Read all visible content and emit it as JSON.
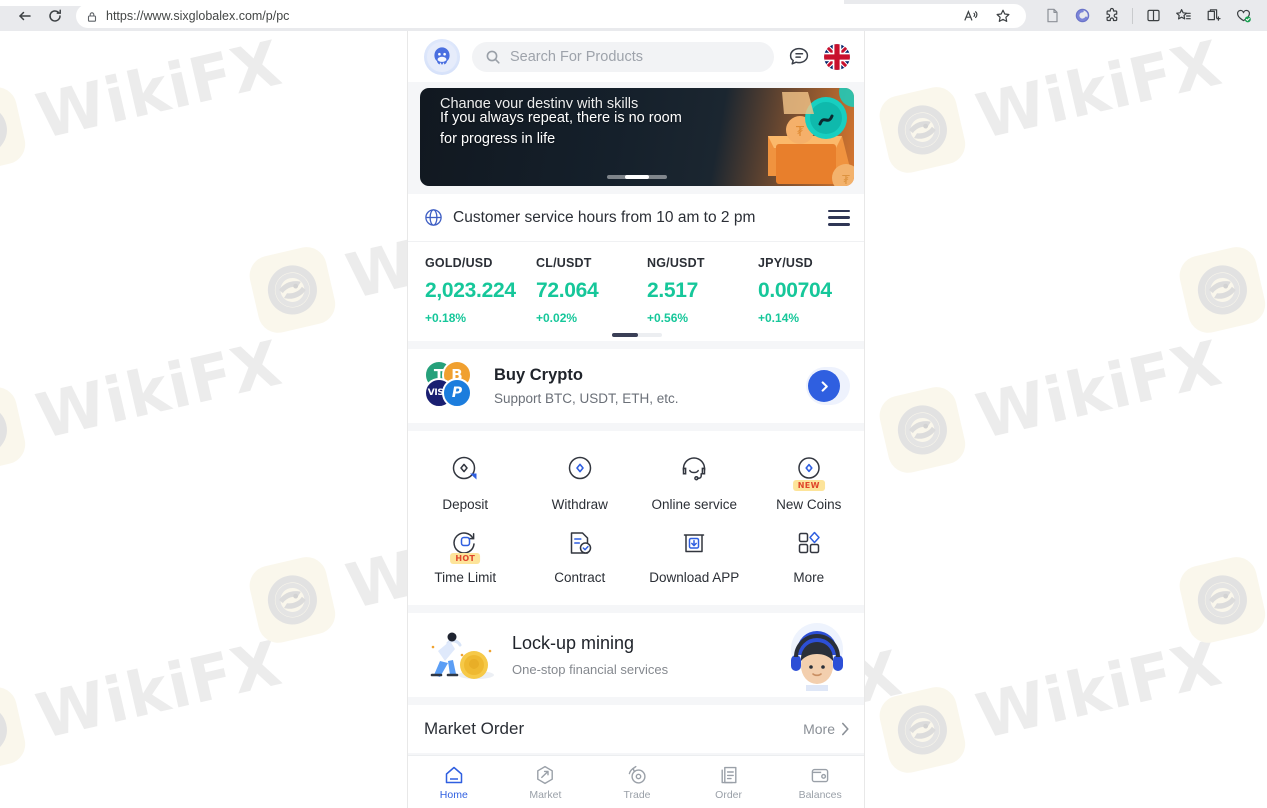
{
  "browser": {
    "url": "https://www.sixglobalex.com/p/pc",
    "back_label": "Back",
    "refresh_label": "Refresh",
    "read_aloud_label": "Read aloud",
    "favorite_label": "Add to favorites",
    "icons": {
      "back": "back-arrow-icon",
      "refresh": "refresh-icon",
      "lock": "site-info-lock-icon",
      "read_aloud": "read-aloud-icon",
      "star": "favorite-star-icon",
      "reading": "reading-view-icon",
      "copilot": "copilot-icon",
      "extensions": "extensions-icon",
      "split": "split-screen-icon",
      "collections": "collections-icon",
      "add_tab": "browser-essentials-icon",
      "health": "browser-health-icon"
    }
  },
  "watermark": {
    "text": "WikiFX"
  },
  "app": {
    "header": {
      "logo": "sixglobalex-logo",
      "search_placeholder": "Search For Products",
      "chat_icon": "chat-bubble-icon",
      "language_flag": "uk-flag-icon"
    },
    "banner": {
      "line_clipped": "Change your destiny with skills",
      "line1": "If you always repeat, there is no room",
      "line2": "for progress in life"
    },
    "service_notice": {
      "text": "Customer service hours from 10 am to 2 pm",
      "globe_icon": "globe-icon",
      "menu_icon": "hamburger-menu-icon"
    },
    "tickers": [
      {
        "pair": "GOLD/USD",
        "price": "2,023.224",
        "change": "+0.18%"
      },
      {
        "pair": "CL/USDT",
        "price": "72.064",
        "change": "+0.02%"
      },
      {
        "pair": "NG/USDT",
        "price": "2.517",
        "change": "+0.56%"
      },
      {
        "pair": "JPY/USD",
        "price": "0.00704",
        "change": "+0.14%"
      }
    ],
    "buy_crypto": {
      "title": "Buy Crypto",
      "subtitle": "Support BTC, USDT, ETH, etc.",
      "coin_usdt": "T",
      "coin_btc": "B",
      "coin_visa": "VISA",
      "coin_paypal": "P",
      "arrow_icon": "chevron-right-icon"
    },
    "quick_actions": [
      {
        "label": "Deposit",
        "icon": "deposit-icon",
        "badge": ""
      },
      {
        "label": "Withdraw",
        "icon": "withdraw-icon",
        "badge": ""
      },
      {
        "label": "Online service",
        "icon": "headset-icon",
        "badge": ""
      },
      {
        "label": "New Coins",
        "icon": "new-coins-icon",
        "badge": "NEW"
      },
      {
        "label": "Time Limit",
        "icon": "time-limit-icon",
        "badge": "HOT"
      },
      {
        "label": "Contract",
        "icon": "contract-icon",
        "badge": ""
      },
      {
        "label": "Download APP",
        "icon": "download-app-icon",
        "badge": ""
      },
      {
        "label": "More",
        "icon": "more-grid-icon",
        "badge": ""
      }
    ],
    "lockup": {
      "title": "Lock-up mining",
      "subtitle": "One-stop financial services",
      "art_icon": "mining-illustration",
      "mascot_icon": "support-agent-mascot"
    },
    "market_order": {
      "title": "Market Order",
      "more_label": "More",
      "more_icon": "chevron-right-icon"
    },
    "tabbar": [
      {
        "label": "Home",
        "icon": "home-icon",
        "active": true
      },
      {
        "label": "Market",
        "icon": "market-icon",
        "active": false
      },
      {
        "label": "Trade",
        "icon": "trade-icon",
        "active": false
      },
      {
        "label": "Order",
        "icon": "order-icon",
        "active": false
      },
      {
        "label": "Balances",
        "icon": "balances-icon",
        "active": false
      }
    ]
  },
  "colors": {
    "accent_blue": "#2f5fe0",
    "up_green": "#16c79a",
    "badge_yellow": "#fde49a",
    "badge_red": "#e0462b"
  }
}
